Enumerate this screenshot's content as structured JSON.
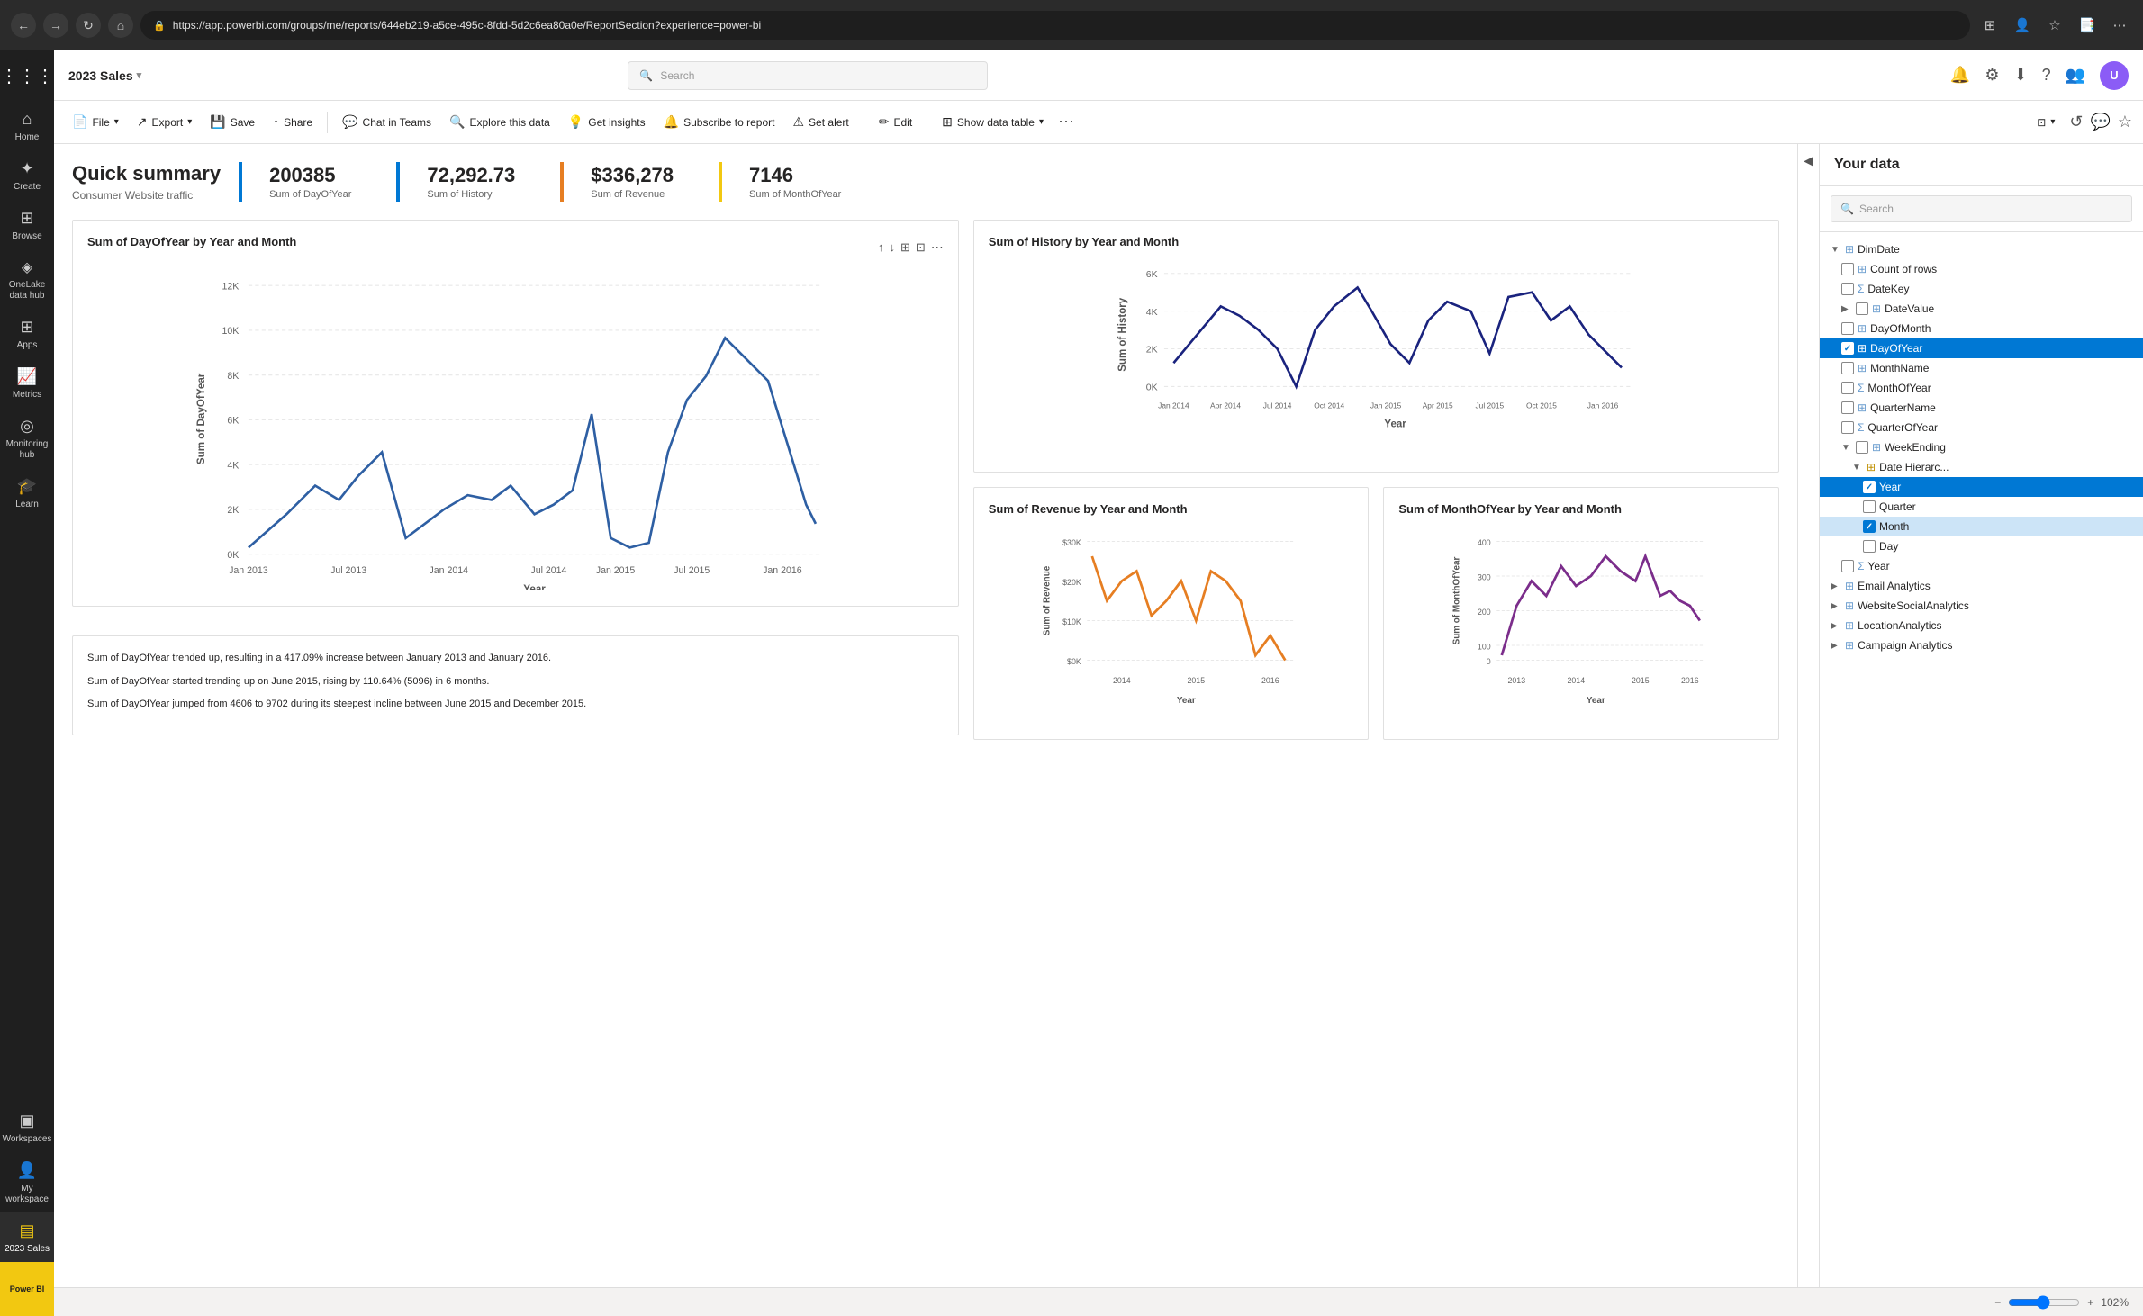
{
  "browser": {
    "url": "https://app.powerbi.com/groups/me/reports/644eb219-a5ce-495c-8fdd-5d2c6ea80a0e/ReportSection?experience=power-bi",
    "nav_back": "←",
    "nav_forward": "→",
    "nav_refresh": "↻"
  },
  "topbar": {
    "title": "2023 Sales",
    "search_placeholder": "Search"
  },
  "toolbar": {
    "file_label": "File",
    "export_label": "Export",
    "save_label": "Save",
    "share_label": "Share",
    "chat_in_teams_label": "Chat in Teams",
    "explore_label": "Explore this data",
    "get_insights_label": "Get insights",
    "subscribe_label": "Subscribe to report",
    "set_alert_label": "Set alert",
    "edit_label": "Edit",
    "show_data_label": "Show data table"
  },
  "quick_summary": {
    "title": "Quick summary",
    "subtitle": "Consumer Website traffic",
    "kpi1_value": "200385",
    "kpi1_label": "Sum of DayOfYear",
    "kpi2_value": "72,292.73",
    "kpi2_label": "Sum of History",
    "kpi3_value": "$336,278",
    "kpi3_label": "Sum of Revenue",
    "kpi4_value": "7146",
    "kpi4_label": "Sum of MonthOfYear"
  },
  "chart1": {
    "title": "Sum of DayOfYear by Year and Month",
    "y_axis_label": "Sum of DayOfYear",
    "x_axis_label": "Year",
    "x_ticks": [
      "Jan 2013",
      "Jul 2013",
      "Jan 2014",
      "Jul 2014",
      "Jan 2015",
      "Jul 2015",
      "Jan 2016"
    ],
    "y_ticks": [
      "0K",
      "2K",
      "4K",
      "6K",
      "8K",
      "10K",
      "12K"
    ]
  },
  "chart2": {
    "title": "Sum of History by Year and Month",
    "y_axis_label": "Sum of History",
    "x_axis_label": "Year",
    "x_ticks": [
      "Jan 2014",
      "Apr 2014",
      "Jul 2014",
      "Oct 2014",
      "Jan 2015",
      "Apr 2015",
      "Jul 2015",
      "Oct 2015",
      "Jan 2016"
    ],
    "y_ticks": [
      "0K",
      "2K",
      "4K",
      "6K"
    ]
  },
  "chart3": {
    "title": "Sum of Revenue by Year and Month",
    "y_axis_label": "Sum of Revenue",
    "x_axis_label": "Year",
    "x_ticks": [
      "2014",
      "2015",
      "2016"
    ],
    "y_ticks": [
      "$0K",
      "$10K",
      "$20K",
      "$30K"
    ]
  },
  "chart4": {
    "title": "Sum of MonthOfYear by Year and Month",
    "y_axis_label": "Sum of MonthOfYear",
    "x_axis_label": "Year",
    "x_ticks": [
      "2013",
      "2014",
      "2015",
      "2016"
    ],
    "y_ticks": [
      "0",
      "100",
      "200",
      "300",
      "400"
    ]
  },
  "insights": [
    "Sum of DayOfYear trended up, resulting in a 417.09% increase between January 2013 and January 2016.",
    "Sum of DayOfYear started trending up on June 2015, rising by 110.64% (5096) in 6 months.",
    "Sum of DayOfYear jumped from 4606 to 9702 during its steepest incline between June 2015 and December 2015."
  ],
  "filters": {
    "header": "Your data",
    "search_placeholder": "Search",
    "tree": [
      {
        "id": "dimdate",
        "label": "DimDate",
        "indent": 0,
        "type": "table",
        "expanded": true,
        "chevron": "▼"
      },
      {
        "id": "count_rows",
        "label": "Count of rows",
        "indent": 1,
        "type": "table",
        "checked": false
      },
      {
        "id": "datekey",
        "label": "DateKey",
        "indent": 1,
        "type": "sigma",
        "checked": false
      },
      {
        "id": "datevalue",
        "label": "DateValue",
        "indent": 1,
        "type": "table",
        "expanded": false,
        "chevron": "▶",
        "checked": false
      },
      {
        "id": "dayofmonth",
        "label": "DayOfMonth",
        "indent": 1,
        "type": "table",
        "checked": false
      },
      {
        "id": "dayofyear",
        "label": "DayOfYear",
        "indent": 1,
        "type": "table",
        "checked": true,
        "highlighted": true
      },
      {
        "id": "monthname",
        "label": "MonthName",
        "indent": 1,
        "type": "table",
        "checked": false
      },
      {
        "id": "monthofyear",
        "label": "MonthOfYear",
        "indent": 1,
        "type": "sigma",
        "checked": false
      },
      {
        "id": "quartername",
        "label": "QuarterName",
        "indent": 1,
        "type": "table",
        "checked": false
      },
      {
        "id": "quarterofyear",
        "label": "QuarterOfYear",
        "indent": 1,
        "type": "sigma",
        "checked": false
      },
      {
        "id": "weekending",
        "label": "WeekEnding",
        "indent": 1,
        "type": "table",
        "expanded": true,
        "chevron": "▼",
        "checked": false
      },
      {
        "id": "date_hierarc",
        "label": "Date Hierarc...",
        "indent": 2,
        "type": "hierarchy",
        "expanded": true,
        "chevron": "▼"
      },
      {
        "id": "year",
        "label": "Year",
        "indent": 3,
        "type": "field",
        "checked": true,
        "highlighted": true
      },
      {
        "id": "quarter_item",
        "label": "Quarter",
        "indent": 3,
        "type": "field",
        "checked": false
      },
      {
        "id": "month",
        "label": "Month",
        "indent": 3,
        "type": "field",
        "checked": true,
        "highlighted2": true
      },
      {
        "id": "day",
        "label": "Day",
        "indent": 3,
        "type": "field",
        "checked": false
      },
      {
        "id": "year2",
        "label": "Year",
        "indent": 1,
        "type": "sigma",
        "checked": false
      },
      {
        "id": "emailanalytics",
        "label": "Email Analytics",
        "indent": 0,
        "type": "table",
        "collapsed": true,
        "chevron": "▶"
      },
      {
        "id": "websitesocialanalytics",
        "label": "WebsiteSocialAnalytics",
        "indent": 0,
        "type": "table",
        "collapsed": true,
        "chevron": "▶"
      },
      {
        "id": "locationanalytics",
        "label": "LocationAnalytics",
        "indent": 0,
        "type": "table",
        "collapsed": true,
        "chevron": "▶"
      },
      {
        "id": "campaignanalytics",
        "label": "Campaign Analytics",
        "indent": 0,
        "type": "table",
        "collapsed": true,
        "chevron": "▶"
      }
    ]
  },
  "sidebar": {
    "items": [
      {
        "id": "home",
        "label": "Home",
        "icon": "⌂"
      },
      {
        "id": "create",
        "label": "Create",
        "icon": "+"
      },
      {
        "id": "browse",
        "label": "Browse",
        "icon": "☰"
      },
      {
        "id": "onelake",
        "label": "OneLake\ndata hub",
        "icon": "⬡"
      },
      {
        "id": "apps",
        "label": "Apps",
        "icon": "▦"
      },
      {
        "id": "metrics",
        "label": "Metrics",
        "icon": "📊"
      },
      {
        "id": "monitoring",
        "label": "Monitoring\nhub",
        "icon": "◉"
      },
      {
        "id": "learn",
        "label": "Learn",
        "icon": "🎓"
      },
      {
        "id": "workspaces",
        "label": "Workspaces",
        "icon": "▣"
      },
      {
        "id": "my_workspace",
        "label": "My\nworkspace",
        "icon": "👤"
      },
      {
        "id": "sales_2023",
        "label": "2023 Sales",
        "icon": "📊",
        "active": true
      }
    ]
  },
  "status_bar": {
    "zoom_label": "102%"
  }
}
